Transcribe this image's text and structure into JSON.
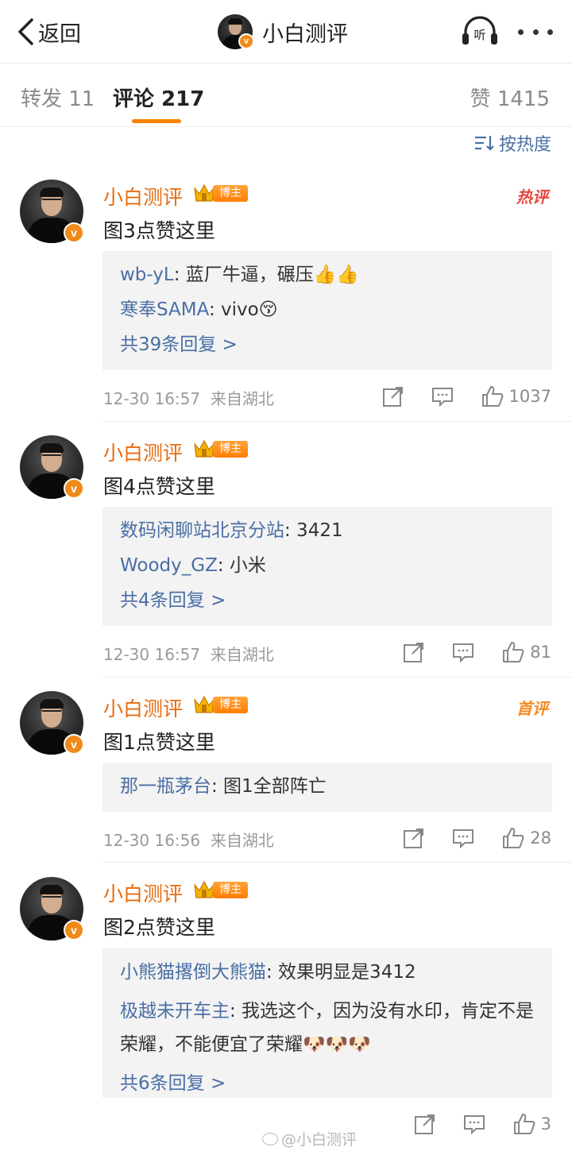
{
  "nav": {
    "back_label": "返回",
    "title": "小白测评",
    "listen_label": "听"
  },
  "tabs": [
    {
      "label": "转发 11",
      "active": false
    },
    {
      "label": "评论 217",
      "active": true
    },
    {
      "label": "赞 1415",
      "active": false
    }
  ],
  "sort_label": "按热度",
  "badge_label": "博主",
  "comments": [
    {
      "user": "小白测评",
      "text": "图3点赞这里",
      "tag": "热评",
      "replies": [
        {
          "user": "wb-yL",
          "text": ": 蓝厂牛逼，碾压👍👍"
        },
        {
          "user": "寒奉SAMA",
          "text": ": vivo😚"
        }
      ],
      "more_replies": "共39条回复 >",
      "time": "12-30 16:57",
      "source": "来自湖北",
      "likes": "1037"
    },
    {
      "user": "小白测评",
      "text": "图4点赞这里",
      "tag": "",
      "replies": [
        {
          "user": "数码闲聊站北京分站",
          "text": ": 3421"
        },
        {
          "user": "Woody_GZ",
          "text": ": 小米"
        }
      ],
      "more_replies": "共4条回复 >",
      "time": "12-30 16:57",
      "source": "来自湖北",
      "likes": "81"
    },
    {
      "user": "小白测评",
      "text": "图1点赞这里",
      "tag": "首评",
      "replies": [
        {
          "user": "那一瓶茅台",
          "text": ": 图1全部阵亡"
        }
      ],
      "more_replies": "",
      "time": "12-30 16:56",
      "source": "来自湖北",
      "likes": "28"
    },
    {
      "user": "小白测评",
      "text": "图2点赞这里",
      "tag": "",
      "replies": [
        {
          "user": "小熊猫撂倒大熊猫",
          "text": ": 效果明显是3412"
        },
        {
          "user": "极越未开车主",
          "text": ": 我选这个，因为没有水印，肯定不是荣耀，不能便宜了荣耀🐶🐶🐶"
        }
      ],
      "more_replies": "共6条回复 >",
      "time": "",
      "source": "",
      "likes": "3"
    }
  ],
  "watermark": "@小白测评",
  "colors": {
    "accent": "#ff8200",
    "username": "#e86b0c",
    "link": "#4a6fa5",
    "hot_tag": "#e5473c",
    "reply_bg": "#f3f3f3"
  },
  "icons": [
    "back-chevron-icon",
    "listen-headphone-icon",
    "more-dots-icon",
    "sort-icon",
    "vip-v-icon",
    "crown-icon",
    "repost-icon",
    "comment-icon",
    "like-thumb-icon",
    "weibo-logo-icon"
  ]
}
